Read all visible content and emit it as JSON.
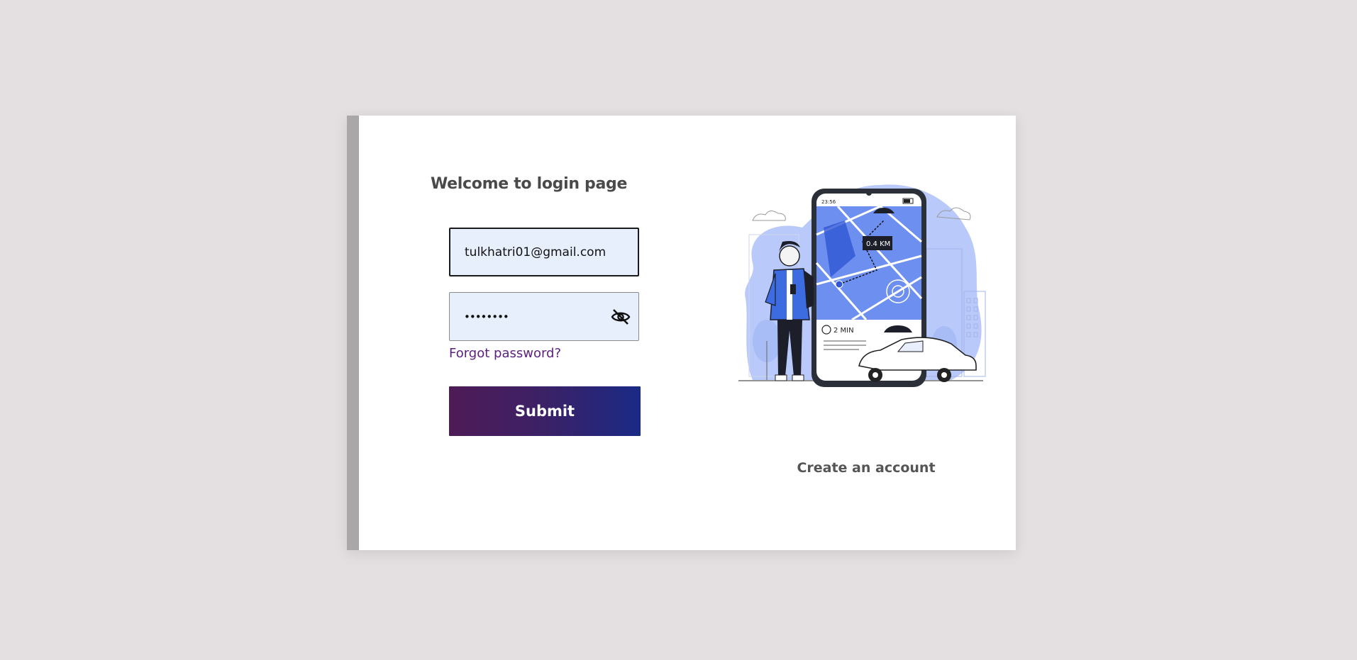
{
  "page": {
    "title": "Welcome to login page"
  },
  "form": {
    "email_value": "tulkhatri01@gmail.com",
    "password_value": "••••••••",
    "forgot_label": "Forgot password?",
    "submit_label": "Submit"
  },
  "illustration": {
    "phone_time": "23:56",
    "distance_label": "0.4 KM",
    "eta_label": "2 MIN"
  },
  "footer": {
    "create_account_label": "Create an account"
  },
  "colors": {
    "background": "#e4dfe0",
    "link": "#5b1f80",
    "button_gradient_start": "#4f1b57",
    "button_gradient_end": "#1a2a86",
    "field_background": "#e8effc",
    "accent_blue": "#3d6be0"
  },
  "icons": {
    "password_toggle": "eye-off-icon"
  }
}
